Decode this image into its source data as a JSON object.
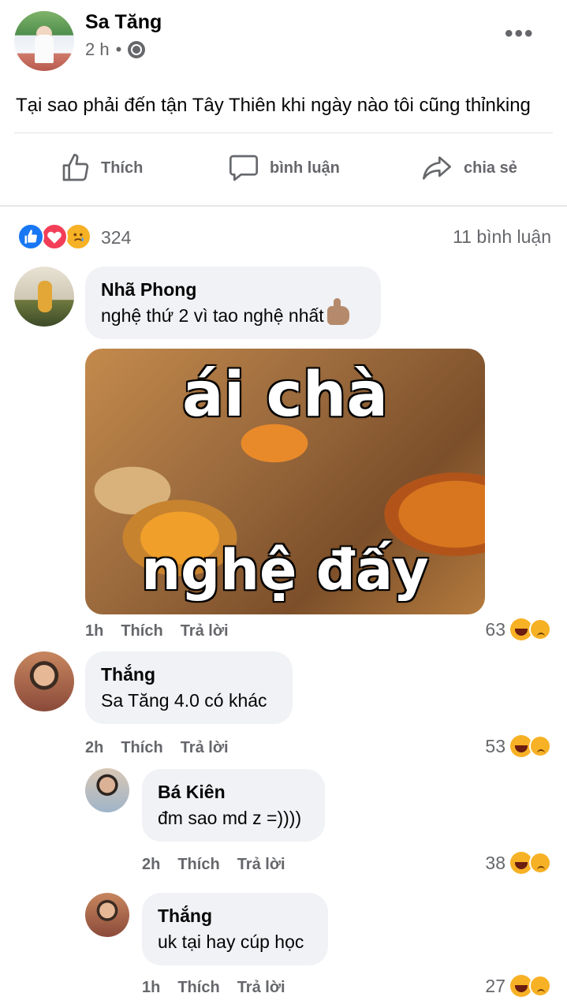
{
  "post": {
    "author": "Sa Tăng",
    "time": "2 h",
    "dot": "•",
    "text": "Tại sao phải đến tận Tây Thiên khi ngày nào tôi cũng thỉnking",
    "more": "•••"
  },
  "actions": {
    "like": "Thích",
    "comment": "bình luận",
    "share": "chia sẻ"
  },
  "reactions": {
    "count": "324",
    "comments_count": "11 bình luận"
  },
  "comments": [
    {
      "name": "Nhã Phong",
      "text": "nghệ thứ 2 vì tao nghệ nhất",
      "time": "1h",
      "like": "Thích",
      "reply": "Trả lời",
      "reactions": "63",
      "meme_top": "ái chà",
      "meme_bottom": "nghệ đấy"
    },
    {
      "name": "Thắng",
      "text": "Sa Tăng 4.0 có khác",
      "time": "2h",
      "like": "Thích",
      "reply": "Trả lời",
      "reactions": "53"
    },
    {
      "name": "Bá Kiên",
      "text": "đm sao md z =))))",
      "time": "2h",
      "like": "Thích",
      "reply": "Trả lời",
      "reactions": "38"
    },
    {
      "name": "Thắng",
      "text": "uk tại hay cúp học",
      "time": "1h",
      "like": "Thích",
      "reply": "Trả lời",
      "reactions": "27"
    }
  ],
  "colors": {
    "accent": "#1877f2",
    "love": "#f33e58",
    "emoji": "#f7b125",
    "muted": "#65676b",
    "bubble": "#f0f2f5"
  }
}
